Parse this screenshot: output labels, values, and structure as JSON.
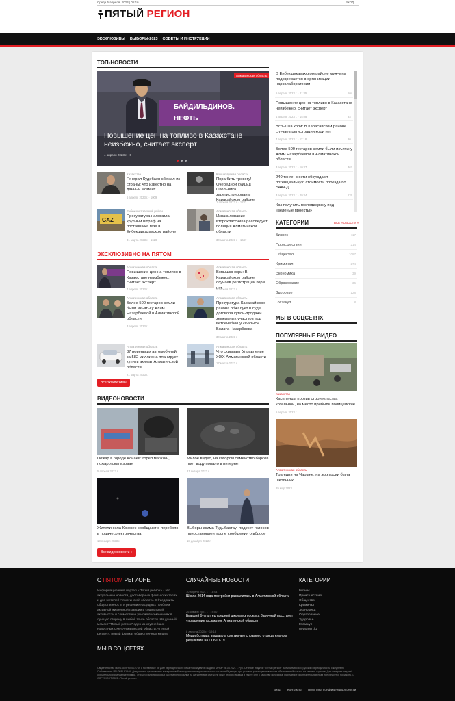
{
  "topbar": {
    "date": "Среда 5 апреля, 2023 | 05:16",
    "login": "ВХОД"
  },
  "logo": {
    "part1": "ПЯТЫЙ",
    "part2": "РЕГИОН"
  },
  "nav": [
    "ЭКСКЛЮЗИВЫ",
    "ВЫБОРЫ-2023",
    "СОВЕТЫ И ИНСТРУКЦИИ"
  ],
  "top": {
    "heading": "ТОП-НОВОСТИ",
    "hero": {
      "badge": "Алматинская область",
      "banner1": "БАЙДИЛЬДИНОВ.",
      "banner2": "НЕФТЬ",
      "title": "Повышение цен на топливо в Казахстане неизбежно, считает эксперт",
      "meta": "4 апреля 2023 г. · 0"
    },
    "grid": [
      {
        "cat": "Казахстан",
        "title": "Генерал Кудебаев сбежал из страны: что известно на данный момент",
        "meta": "5 апреля 2023 г. · 1009"
      },
      {
        "cat": "Кокшетауская область",
        "title": "Пора бить тревогу! Очередной суицид школьника зарегистрирован в Карасайском районе",
        "meta": "1 апреля 2023 г. · 1237"
      },
      {
        "cat": "Енбекшиказахский район",
        "title": "Прокуратура наложила крупный штраф на поставщика газа в Енбекшиказахском районе",
        "meta": "31 марта 2023 г. · 1628"
      },
      {
        "cat": "Алматинская область",
        "title": "Изнасилование второклассника расследует полиция Алматинской области",
        "meta": "30 марта 2023 г. · 1647"
      }
    ]
  },
  "side": [
    {
      "title": "В Енбекшиказахском районе мужчина подозревается в организации нарколаборатории",
      "meta": "5 апреля 2023 г. · 21:45",
      "count": "104"
    },
    {
      "title": "Повышение цен на топливо в Казахстане неизбежно, считает эксперт",
      "meta": "4 апреля 2023 г. · 15:08",
      "count": "93"
    },
    {
      "title": "Вспышка кори: В Карасайском районе случаев регистрации кори нет",
      "meta": "4 апреля 2023 г. · 11:18",
      "count": "80"
    },
    {
      "title": "Более 500 гектаров земли были изъяты у Алим Назарбаевой в Алматинской области",
      "meta": "3 апреля 2023 г. · 10:47",
      "count": "367"
    },
    {
      "title": "240 тенге: в сети обсуждают потенциальную стоимость проезда по БАКАД",
      "meta": "3 апреля 2023 г. · 09:44",
      "count": "115"
    },
    {
      "title": "Как получить господдержку под «зеленые проекты»",
      "meta": "",
      "count": ""
    }
  ],
  "categories": {
    "heading": "КАТЕГОРИИ",
    "all": "ВСЕ НОВОСТИ »",
    "items": [
      {
        "name": "Бизнес",
        "count": "117"
      },
      {
        "name": "Происшествия",
        "count": "214"
      },
      {
        "name": "Общество",
        "count": "1087"
      },
      {
        "name": "Криминал",
        "count": "274"
      },
      {
        "name": "Экономика",
        "count": "39"
      },
      {
        "name": "Образование",
        "count": "36"
      },
      {
        "name": "Здоровье",
        "count": "128"
      },
      {
        "name": "Госзакуп",
        "count": "8"
      }
    ]
  },
  "social": {
    "heading": "МЫ В СОЦСЕТЯХ"
  },
  "popular": {
    "heading": "ПОПУЛЯРНЫЕ ВИДЕО",
    "items": [
      {
        "cat": "Казахстан",
        "title": "Каселенцы против строительства котельной, на место прибыли полицейские",
        "meta": "5 апреля 2023 г."
      },
      {
        "cat": "Алматинская область",
        "title": "Трагедия на Чарыне: на экскурсии была школьник",
        "meta": "29 мар 2023"
      }
    ]
  },
  "exclusive": {
    "heading": "ЭКСКЛЮЗИВНО НА ПЯТОМ",
    "items": [
      {
        "cat": "Алматинская область",
        "title": "Повышение цен на топливо в Казахстане неизбежно, считает эксперт",
        "meta": "4 апреля 2023 г."
      },
      {
        "cat": "Алматинская область",
        "title": "Вспышка кори: В Карасайском районе случаев регистрации кори нет",
        "meta": "4 апреля 2023 г."
      },
      {
        "cat": "Алматинская область",
        "title": "Более 500 гектаров земли были изъяты у Алим Назарбаевой в Алматинской области",
        "meta": "3 апреля 2023 г."
      },
      {
        "cat": "Алматинская область",
        "title": "Прокуратура Карасайского района обжалует в суде договора купли-продажи земельных участков под ветлечебницу «Барыс» Болата Назарбаева",
        "meta": "30 марта 2023 г."
      },
      {
        "cat": "Алматинская область",
        "title": "37 новеньких автомобилей за 582 миллиона планирует купить акимат Алматинской области",
        "meta": "21 марта 2023 г."
      },
      {
        "cat": "Алматинская область",
        "title": "Что скрывает Управление ЖКХ Алматинской области",
        "meta": "17 марта 2023 г."
      }
    ],
    "button": "Все эксклюзивы"
  },
  "videos": {
    "heading": "ВИДЕОНОВОСТИ",
    "items": [
      {
        "title": "Пожар в городе Конаев: горел магазин, пожар локализован",
        "meta": "5 апреля 2023 г."
      },
      {
        "title": "Милое видео, на котором семейство барсов пьет воду попало в интернет",
        "meta": "21 января 2023 г."
      },
      {
        "title": "Жители села Кокозек сообщают о перебоях в подаче электричества",
        "meta": "13 января 2023 г."
      },
      {
        "title": "Выборы акима Тудыбастау: подсчет голосов приостановлен после сообщения о вбросе",
        "meta": "18 декабря 2022 г."
      }
    ],
    "button": "Все видеоновости »"
  },
  "footer": {
    "about": {
      "h1": "О",
      "h2": "ПЯТОМ",
      "h3": "РЕГИОНЕ",
      "text": "Информационный портал «Пятый регион» - это актуальные новости, достоверные факты о жителях и для жителей Алматинской области. Объединить общественность и решение насущных проблем активной жизненной позиции и социальной активности и совместные усилия в изменениях в лучшую сторону в любой точке области. На данный момент “Пятый регион” один из крупнейших новостных СМИ Алматинской области. «Пятый регион», новый формат общественных медиа."
    },
    "social": "МЫ В СОЦСЕТЯХ",
    "random": {
      "heading": "СЛУЧАЙНЫЕ НОВОСТИ",
      "items": [
        {
          "date": "10 апреля 2021 г. · 18:04",
          "title": "Школа 2014 года постройки развалилась в Алматинской области"
        },
        {
          "date": "26 января 2021 г. · 19:00",
          "title": "Бывший бухгалтер средней школы из поселка Заречный восстанет управление госзакупок Алматинской области"
        },
        {
          "date": "8 августа 2020 г. · 19:18",
          "title": "Медработница выдавала фиктивные справки о отрицательном результате на COVID-19"
        }
      ]
    },
    "categories": {
      "heading": "КАТЕГОРИИ",
      "items": [
        "Бизнес",
        "Происшествия",
        "Общество",
        "Криминал",
        "Экономика",
        "Образование",
        "Здоровье",
        "Госзакуп",
        "unwomen.kz"
      ]
    },
    "copyright": "Свидетельство № KZ85VPY00012749 о постановке на учет периодического печатного издания выдано МИОР 06.04.2021 г. Руб. Сетевое издание “Пятый регион” Всем Алматской, русский Периодичность. Ежедневно Собственник: ИП ОВЕЧКИНА. Допускается цитирование материалов без получения предварительного согласия Редакции при условии размещения в тексте обязательной ссылки на сетевое издание. Для интернет-изданий обязательно размещение прямой, открытой для поисковых систем гиперссылки на цитируемые статьи не ниже второго абзаца в тексте или в качестве источника. Нарушение исключительных прав преследуется по закону. © COPYRIGHT 2023 «Пятый регион»",
    "links": [
      "Вход",
      "Контакты",
      "Политика конфиденциальности"
    ]
  }
}
